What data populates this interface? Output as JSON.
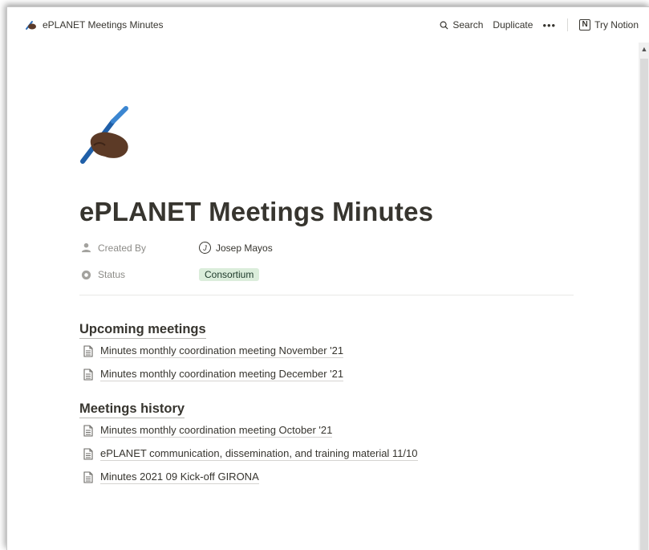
{
  "topbar": {
    "breadcrumb": "ePLANET Meetings Minutes",
    "search_label": "Search",
    "duplicate_label": "Duplicate",
    "more_label": "•••",
    "try_notion_label": "Try Notion",
    "notion_logo_letter": "N"
  },
  "page": {
    "icon": "writing-hand-emoji",
    "title": "ePLANET Meetings Minutes",
    "properties": [
      {
        "name": "Created By",
        "icon": "person-icon",
        "value": "Josep Mayos",
        "avatar_letter": "J"
      },
      {
        "name": "Status",
        "icon": "status-circle-icon",
        "value": "Consortium"
      }
    ],
    "status_color": "#dbeddb"
  },
  "sections": [
    {
      "heading": "Upcoming meetings",
      "links": [
        "Minutes monthly coordination meeting November '21",
        "Minutes monthly coordination meeting December '21"
      ]
    },
    {
      "heading": "Meetings history",
      "links": [
        "Minutes monthly coordination meeting October '21",
        "ePLANET communication, dissemination, and training material 11/10",
        "Minutes 2021 09 Kick-off GIRONA"
      ]
    }
  ]
}
